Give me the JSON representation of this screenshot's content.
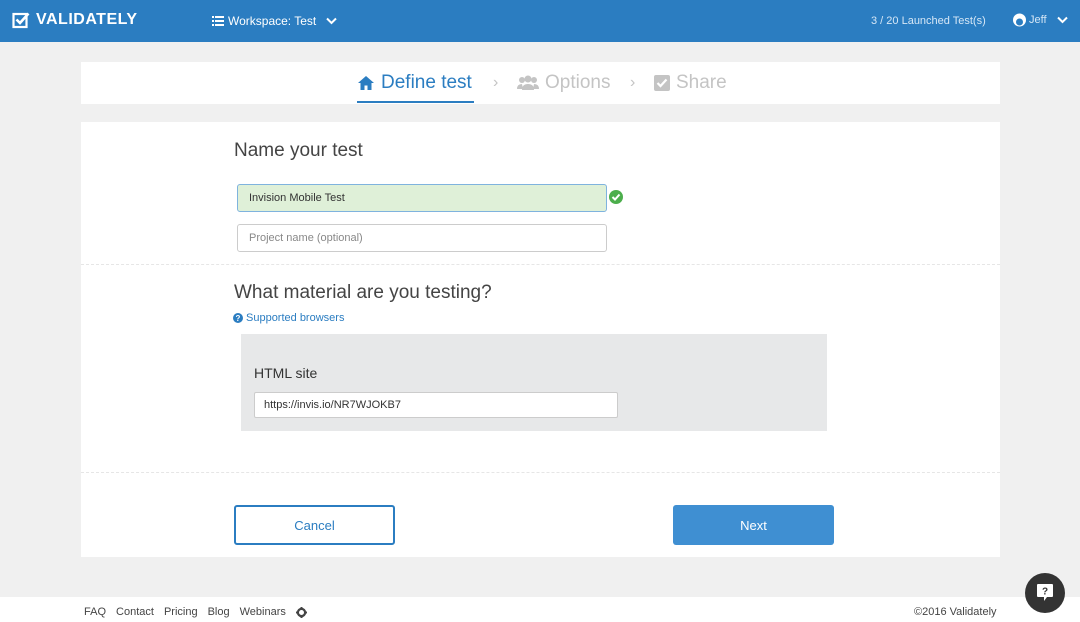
{
  "header": {
    "logo_text": "VALIDATELY",
    "workspace_label": "Workspace: Test",
    "launched_tests": "3 / 20 Launched Test(s)",
    "user_name": "Jeff"
  },
  "steps": [
    {
      "label": "Define test",
      "state": "active",
      "icon": "home-icon"
    },
    {
      "label": "Options",
      "state": "inactive",
      "icon": "users-icon"
    },
    {
      "label": "Share",
      "state": "inactive",
      "icon": "check-square-icon"
    }
  ],
  "form": {
    "name_section_title": "Name your test",
    "test_name_value": "Invision Mobile Test",
    "project_placeholder": "Project name (optional)",
    "material_section_title": "What material are you testing?",
    "supported_browsers_link": "Supported browsers",
    "material_type_label": "HTML site",
    "url_value": "https://invis.io/NR7WJOKB7",
    "cancel_label": "Cancel",
    "next_label": "Next"
  },
  "footer": {
    "links": [
      "FAQ",
      "Contact",
      "Pricing",
      "Blog",
      "Webinars"
    ],
    "copyright": "©2016 Validately"
  },
  "colors": {
    "brand_blue": "#2b7dc1",
    "success_green": "#4cae4c",
    "valid_field_bg": "#dff0d8"
  }
}
